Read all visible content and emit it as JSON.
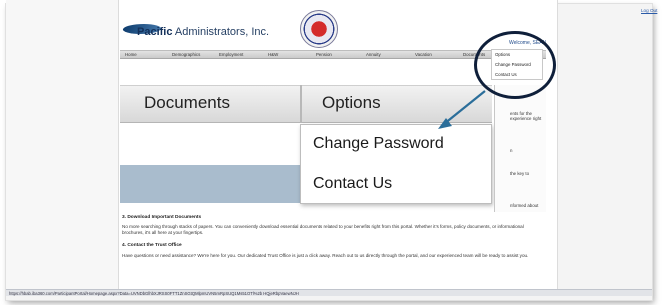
{
  "header": {
    "logout": "Log Out",
    "logo_bold": "Pacific",
    "logo_rest": " Administrators, Inc.",
    "welcome": "Welcome, SEAN"
  },
  "nav": {
    "items": [
      "Home",
      "Demographics",
      "Employment",
      "H&W",
      "Pension",
      "Annuity",
      "Vacation",
      "Documents"
    ]
  },
  "user_menu": {
    "items": [
      "Options",
      "Change Password",
      "Contact Us"
    ]
  },
  "zoom": {
    "documents": "Documents",
    "options": "Options",
    "menu": [
      "Change Password",
      "Contact Us"
    ]
  },
  "right_col": {
    "line1": "ents for the",
    "line2": "experience right",
    "line3": "n",
    "line4": "the key to",
    "line5": "nformed about"
  },
  "content": {
    "section3_title": "3. Download Important Documents",
    "section3_body": "No more searching through stacks of papers. You can conveniently download essential documents related to your benefits right from this portal. Whether it's forms, policy documents, or informational brochures, it's all here at your fingertips.",
    "section4_title": "4. Contact the Trust Office",
    "section4_body": "Have questions or need assistance? We're here for you. Our dedicated Trust Office is just a click away. Reach out to us directly through the portal, and our experienced team will be ready to assist you."
  },
  "statusbar": {
    "url": "https://hbab.iba360.com/ParticipantPortal/Homepage.aspx?Data=UVNDbGlhbXJRSS0FTT1ZnSGtQMlpmUVN5mRpSUQ1Ms51OTl%2b HQjeRbpVaewNJH"
  },
  "colors": {
    "annotation": "#0f1f3a",
    "arrow": "#2b6e9a",
    "link": "#2a5aa8",
    "band": "#a9bccd"
  }
}
